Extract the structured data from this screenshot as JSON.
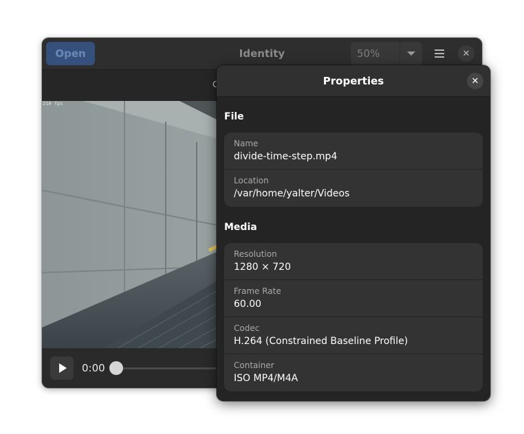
{
  "main_window": {
    "open_label": "Open",
    "title": "Identity",
    "zoom_value": "50%",
    "subbar_label": "C",
    "fps_label": "210 fps",
    "time": "0:00"
  },
  "properties": {
    "title": "Properties",
    "file_section": {
      "heading": "File",
      "rows": [
        {
          "label": "Name",
          "value": "divide-time-step.mp4"
        },
        {
          "label": "Location",
          "value": "/var/home/yalter/Videos"
        }
      ]
    },
    "media_section": {
      "heading": "Media",
      "rows": [
        {
          "label": "Resolution",
          "value": "1280 × 720"
        },
        {
          "label": "Frame Rate",
          "value": "60.00"
        },
        {
          "label": "Codec",
          "value": "H.264 (Constrained Baseline Profile)"
        },
        {
          "label": "Container",
          "value": "ISO MP4/M4A"
        }
      ]
    }
  },
  "icons": {
    "close": "close-icon",
    "menu": "hamburger-menu-icon",
    "dropdown": "chevron-down-icon",
    "play": "play-icon"
  },
  "colors": {
    "accent": "#35507b",
    "window_bg": "#242424",
    "row_bg": "#333333"
  }
}
